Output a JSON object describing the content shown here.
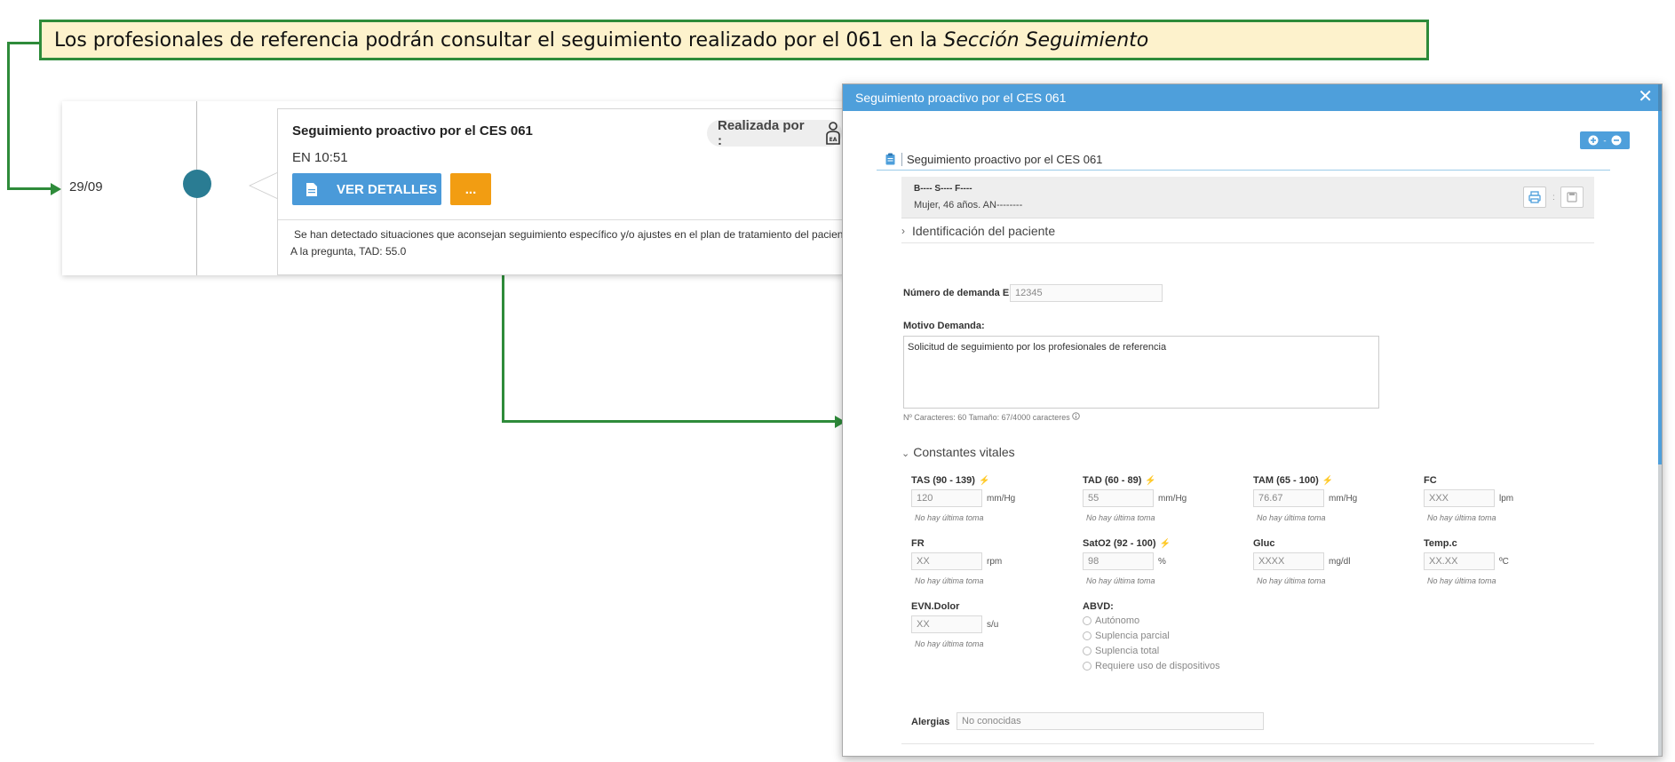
{
  "callout": {
    "text": "Los profesionales de referencia podrán consultar el seguimiento realizado por el 061 en la",
    "emphasis": "Sección Seguimiento"
  },
  "timeline": {
    "date": "29/09",
    "card_title": "Seguimiento proactivo por el CES 061",
    "time": "EN 10:51",
    "realizada_label": "Realizada por :",
    "ver_detalles_label": "VER DETALLES",
    "more_label": "...",
    "detail_line1": "Se han detectado situaciones que aconsejan seguimiento específico y/o ajustes en el plan de tratamiento del paciente:",
    "detail_line2": "A la pregunta, TAD: 55.0"
  },
  "modal": {
    "title": "Seguimiento proactivo por el CES 061",
    "close_glyph": "✕",
    "section_title": "Seguimiento proactivo por el CES 061",
    "patient_name": "B---- S---- F----",
    "patient_info": "Mujer, 46 años. AN--------",
    "patient_sep": ":",
    "identificacion_label": "Identificación del paciente",
    "demanda_label": "Número de demanda EPES",
    "demanda_value": "12345",
    "motivo_label": "Motivo Demanda:",
    "motivo_value": "Solicitud de seguimiento por los profesionales de referencia",
    "counter_text": "Nº Caracteres: 60 Tamaño: 67/4000 caracteres",
    "constantes_label": "Constantes vitales",
    "no_toma": "No hay última toma",
    "vitals_row1": [
      {
        "label": "TAS (90 - 139)",
        "plug": true,
        "value": "120",
        "unit": "mm/Hg"
      },
      {
        "label": "TAD (60 - 89)",
        "plug": true,
        "value": "55",
        "unit": "mm/Hg"
      },
      {
        "label": "TAM (65 - 100)",
        "plug": true,
        "value": "76.67",
        "unit": "mm/Hg"
      },
      {
        "label": "FC",
        "plug": false,
        "value": "XXX",
        "unit": "lpm"
      }
    ],
    "vitals_row2": [
      {
        "label": "FR",
        "plug": false,
        "value": "XX",
        "unit": "rpm"
      },
      {
        "label": "SatO2 (92 - 100)",
        "plug": true,
        "value": "98",
        "unit": "%"
      },
      {
        "label": "Gluc",
        "plug": false,
        "value": "XXXX",
        "unit": "mg/dl"
      },
      {
        "label": "Temp.c",
        "plug": false,
        "value": "XX.XX",
        "unit": "ºC"
      }
    ],
    "dolor": {
      "label": "EVN.Dolor",
      "value": "XX",
      "unit": "s/u"
    },
    "abvd_label": "ABVD:",
    "abvd_options": [
      "Autónomo",
      "Suplencia parcial",
      "Suplencia total",
      "Requiere uso de dispositivos"
    ],
    "alergias_label": "Alergias",
    "alergias_value": "No conocidas",
    "plus_minus": "+ - −"
  },
  "colors": {
    "callout_border": "#2e8b3a",
    "callout_bg": "#fdf2cc",
    "modal_header": "#4e9fdb",
    "ver_detalles": "#4a9ad9",
    "more_button": "#f29d12",
    "timeline_dot": "#2a7c93"
  }
}
